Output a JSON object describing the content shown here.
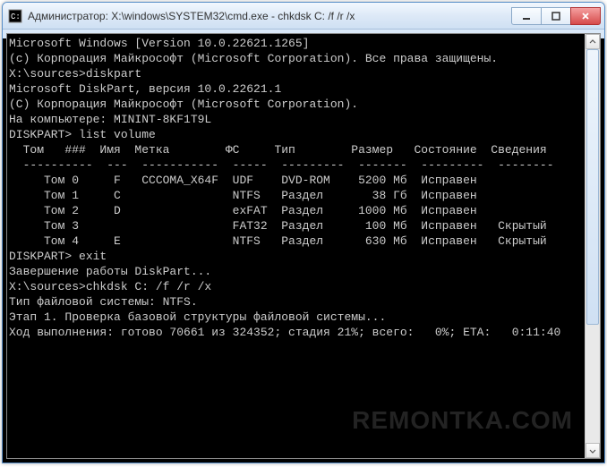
{
  "window": {
    "title": "Администратор: X:\\windows\\SYSTEM32\\cmd.exe - chkdsk  C: /f /r /x"
  },
  "terminal": {
    "banner1": "Microsoft Windows [Version 10.0.22621.1265]",
    "banner2": "(c) Корпорация Майкрософт (Microsoft Corporation). Все права защищены.",
    "blank": "",
    "prompt1": "X:\\sources>diskpart",
    "dp_banner1": "Microsoft DiskPart, версия 10.0.22621.1",
    "dp_banner2": "(C) Корпорация Майкрософт (Microsoft Corporation).",
    "dp_computer": "На компьютере: MININT-8KF1T9L",
    "dp_prompt1": "DISKPART> list volume",
    "table_header": "  Том   ###  Имя  Метка        ФС     Тип        Размер   Состояние  Сведения",
    "table_divider": "  ----------  ---  -----------  -----  ---------  -------  ---------  --------",
    "rows": [
      "     Том 0     F   CCCOMA_X64F  UDF    DVD-ROM    5200 Мб  Исправен",
      "     Том 1     C                NTFS   Раздел       38 Гб  Исправен",
      "     Том 2     D                exFAT  Раздел     1000 Мб  Исправен",
      "     Том 3                      FAT32  Раздел      100 Мб  Исправен   Скрытый",
      "     Том 4     E                NTFS   Раздел      630 Мб  Исправен   Скрытый"
    ],
    "dp_prompt2": "DISKPART> exit",
    "dp_exit_msg": "Завершение работы DiskPart...",
    "prompt2": "X:\\sources>chkdsk C: /f /r /x",
    "fs_type": "Тип файловой системы: NTFS.",
    "stage1": "Этап 1. Проверка базовой структуры файловой системы...",
    "progress": "Ход выполнения: готово 70661 из 324352; стадия 21%; всего:   0%; ETA:   0:11:40"
  },
  "volume_table": {
    "columns": [
      "Том",
      "###",
      "Имя",
      "Метка",
      "ФС",
      "Тип",
      "Размер",
      "Состояние",
      "Сведения"
    ],
    "data": [
      {
        "num": "Том 0",
        "letter": "F",
        "label": "CCCOMA_X64F",
        "fs": "UDF",
        "type": "DVD-ROM",
        "size": "5200 Мб",
        "status": "Исправен",
        "info": ""
      },
      {
        "num": "Том 1",
        "letter": "C",
        "label": "",
        "fs": "NTFS",
        "type": "Раздел",
        "size": "38 Гб",
        "status": "Исправен",
        "info": ""
      },
      {
        "num": "Том 2",
        "letter": "D",
        "label": "",
        "fs": "exFAT",
        "type": "Раздел",
        "size": "1000 Мб",
        "status": "Исправен",
        "info": ""
      },
      {
        "num": "Том 3",
        "letter": "",
        "label": "",
        "fs": "FAT32",
        "type": "Раздел",
        "size": "100 Мб",
        "status": "Исправен",
        "info": "Скрытый"
      },
      {
        "num": "Том 4",
        "letter": "E",
        "label": "",
        "fs": "NTFS",
        "type": "Раздел",
        "size": "630 Мб",
        "status": "Исправен",
        "info": "Скрытый"
      }
    ]
  },
  "watermark": "REMONTKA.COM"
}
